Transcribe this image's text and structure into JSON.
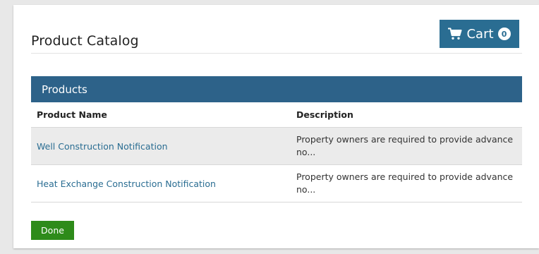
{
  "panel": {
    "title": "Product Catalog"
  },
  "cart": {
    "label": "Cart",
    "count": "0",
    "icon": "shopping-cart-icon"
  },
  "products": {
    "header": "Products",
    "columns": {
      "name": "Product Name",
      "description": "Description"
    },
    "rows": [
      {
        "name": "Well Construction Notification",
        "description": "Property owners are required to provide advance no..."
      },
      {
        "name": "Heat Exchange Construction Notification",
        "description": "Property owners are required to provide advance no..."
      }
    ]
  },
  "actions": {
    "done_label": "Done"
  },
  "colors": {
    "accent": "#2a6d92",
    "header_bar": "#2d6289",
    "done_green": "#2e8b1a",
    "row_shade": "#ebebeb"
  }
}
